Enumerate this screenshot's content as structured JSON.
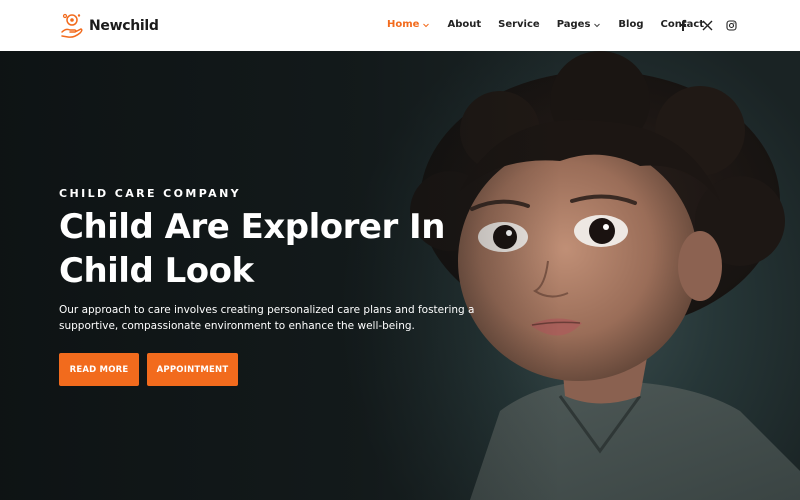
{
  "brand": {
    "name": "Newchild",
    "accent": "#f26b1d"
  },
  "nav": [
    {
      "label": "Home",
      "active": true,
      "dropdown": true
    },
    {
      "label": "About",
      "active": false,
      "dropdown": false
    },
    {
      "label": "Service",
      "active": false,
      "dropdown": false
    },
    {
      "label": "Pages",
      "active": false,
      "dropdown": true
    },
    {
      "label": "Blog",
      "active": false,
      "dropdown": false
    },
    {
      "label": "Contact",
      "active": false,
      "dropdown": false
    }
  ],
  "social": [
    "facebook-icon",
    "x-icon",
    "instagram-icon"
  ],
  "hero": {
    "eyebrow": "CHILD CARE COMPANY",
    "headline_line1": "Child Are Explorer In",
    "headline_line2": "Child Look",
    "description_line1": "Our approach to care involves creating personalized care plans and fostering a",
    "description_line2": "supportive, compassionate environment to enhance the well-being.",
    "buttons": {
      "read_more": "READ MORE",
      "appointment": "APPOINTMENT"
    }
  }
}
